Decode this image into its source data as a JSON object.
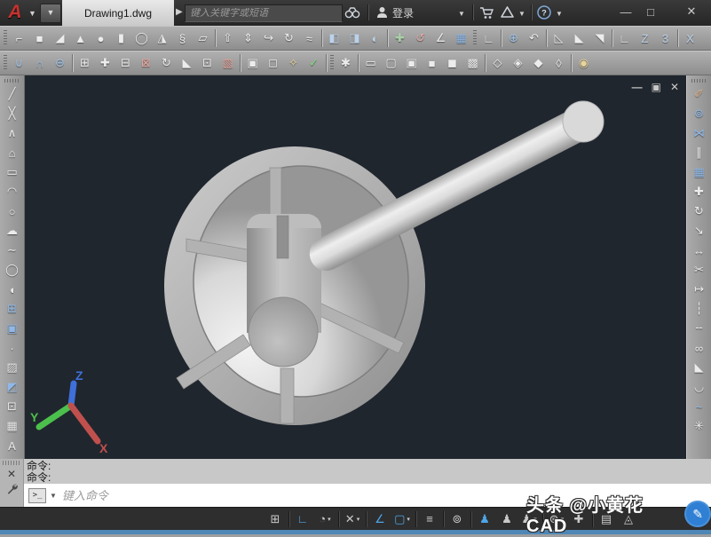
{
  "titlebar": {
    "logo_glyph": "A",
    "doc_title": "Drawing1.dwg",
    "search_placeholder": "键入关键字或短语",
    "login_label": "登录",
    "window_buttons": {
      "minimize": "—",
      "maximize": "□",
      "close": "✕"
    }
  },
  "toolbar_row1": {
    "items": [
      {
        "type": "grip",
        "name": "toolbar-grip"
      },
      {
        "name": "polysolid-icon",
        "glyph": "⌐"
      },
      {
        "name": "box-icon",
        "glyph": "■"
      },
      {
        "name": "wedge-icon",
        "glyph": "◢"
      },
      {
        "name": "cone-icon",
        "glyph": "▲"
      },
      {
        "name": "sphere-icon",
        "glyph": "●"
      },
      {
        "name": "cylinder-icon",
        "glyph": "▮"
      },
      {
        "name": "torus-icon",
        "glyph": "◯"
      },
      {
        "name": "pyramid-icon",
        "glyph": "◮"
      },
      {
        "name": "helix-icon",
        "glyph": "§"
      },
      {
        "name": "planar-surface-icon",
        "glyph": "▱"
      },
      {
        "type": "sep",
        "name": "toolbar-separator"
      },
      {
        "name": "extrude-icon",
        "glyph": "⇧"
      },
      {
        "name": "presspull-icon",
        "glyph": "⇕"
      },
      {
        "name": "sweep-icon",
        "glyph": "↪"
      },
      {
        "name": "revolve-icon",
        "glyph": "↻"
      },
      {
        "name": "loft-icon",
        "glyph": "≈"
      },
      {
        "type": "sep",
        "name": "toolbar-separator"
      },
      {
        "name": "section-plane-icon",
        "glyph": "◧",
        "color": "#bcd2ea"
      },
      {
        "name": "slice-icon",
        "glyph": "◨",
        "color": "#bcd2ea"
      },
      {
        "name": "interfere-icon",
        "glyph": "◐",
        "color": "#bcd2ea"
      },
      {
        "type": "sep",
        "name": "toolbar-separator"
      },
      {
        "name": "3d-move-icon",
        "glyph": "✚",
        "color": "#a8d0a8"
      },
      {
        "name": "3d-rotate-icon",
        "glyph": "↺",
        "color": "#e0a8a8"
      },
      {
        "name": "3d-align-icon",
        "glyph": "∠"
      },
      {
        "name": "3d-array-icon",
        "glyph": "▦",
        "color": "#8fb8e8"
      },
      {
        "type": "grip",
        "name": "toolbar-grip"
      },
      {
        "name": "ucs-icon",
        "glyph": "∟"
      },
      {
        "type": "sep",
        "name": "toolbar-separator"
      },
      {
        "name": "ucs-world-icon",
        "glyph": "⊕",
        "color": "#9fc3e8"
      },
      {
        "name": "ucs-previous-icon",
        "glyph": "↶"
      },
      {
        "type": "sep",
        "name": "toolbar-separator"
      },
      {
        "name": "ucs-face-icon",
        "glyph": "◺"
      },
      {
        "name": "ucs-object-icon",
        "glyph": "◣"
      },
      {
        "name": "ucs-view-icon",
        "glyph": "◥"
      },
      {
        "type": "sep",
        "name": "toolbar-separator"
      },
      {
        "name": "ucs-origin-icon",
        "glyph": "∟"
      },
      {
        "name": "ucs-z-axis-icon",
        "glyph": "Z",
        "color": "#bcd2ea"
      },
      {
        "name": "ucs-3-point-icon",
        "glyph": "3",
        "color": "#bcd2ea"
      },
      {
        "type": "sep",
        "name": "toolbar-separator"
      },
      {
        "name": "ucs-rotate-x-icon",
        "glyph": "X",
        "color": "#bcd2ea"
      }
    ]
  },
  "toolbar_row2": {
    "items": [
      {
        "type": "grip",
        "name": "toolbar-grip"
      },
      {
        "name": "union-icon",
        "glyph": "∪",
        "color": "#9fc3e8"
      },
      {
        "name": "intersect-icon",
        "glyph": "∩",
        "color": "#9fc3e8"
      },
      {
        "name": "subtract-icon",
        "glyph": "⊖",
        "color": "#9fc3e8"
      },
      {
        "type": "sep",
        "name": "toolbar-separator"
      },
      {
        "name": "extrude-faces-icon",
        "glyph": "⊞"
      },
      {
        "name": "move-faces-icon",
        "glyph": "✚"
      },
      {
        "name": "copy-faces-icon",
        "glyph": "⊟"
      },
      {
        "name": "delete-faces-icon",
        "glyph": "⊠",
        "color": "#e8a8a0"
      },
      {
        "name": "rotate-faces-icon",
        "glyph": "↻"
      },
      {
        "name": "taper-faces-icon",
        "glyph": "◣"
      },
      {
        "name": "offset-faces-icon",
        "glyph": "⊡"
      },
      {
        "name": "color-faces-icon",
        "glyph": "▧",
        "color": "#e8a8a0"
      },
      {
        "type": "sep",
        "name": "toolbar-separator"
      },
      {
        "name": "shell-icon",
        "glyph": "▣"
      },
      {
        "name": "separate-icon",
        "glyph": "◻"
      },
      {
        "name": "imprint-icon",
        "glyph": "✧",
        "color": "#e8d49a"
      },
      {
        "name": "check-icon",
        "glyph": "✓",
        "color": "#7ddb7d"
      },
      {
        "type": "sep",
        "name": "toolbar-separator"
      },
      {
        "type": "grip",
        "name": "toolbar-grip"
      },
      {
        "name": "extract-edges-icon",
        "glyph": "✱"
      },
      {
        "type": "sep",
        "name": "toolbar-separator"
      },
      {
        "name": "visual-style-2d-wireframe-icon",
        "glyph": "▭"
      },
      {
        "name": "visual-style-wireframe-icon",
        "glyph": "▢"
      },
      {
        "name": "visual-style-hidden-icon",
        "glyph": "▣"
      },
      {
        "name": "visual-style-realistic-icon",
        "glyph": "■"
      },
      {
        "name": "visual-style-conceptual-icon",
        "glyph": "◼"
      },
      {
        "name": "visual-style-shaded-icon",
        "glyph": "▩"
      },
      {
        "type": "sep",
        "name": "toolbar-separator"
      },
      {
        "name": "view-sw-isometric-icon",
        "glyph": "◇"
      },
      {
        "name": "view-se-isometric-icon",
        "glyph": "◈"
      },
      {
        "name": "view-ne-isometric-icon",
        "glyph": "◆"
      },
      {
        "name": "view-nw-isometric-icon",
        "glyph": "◊"
      },
      {
        "type": "sep",
        "name": "toolbar-separator"
      },
      {
        "name": "render-icon",
        "glyph": "◉",
        "color": "#e8d49a"
      }
    ]
  },
  "left_toolbar": {
    "items": [
      {
        "type": "grip",
        "name": "toolbar-grip"
      },
      {
        "name": "line-icon",
        "glyph": "╱"
      },
      {
        "name": "construction-line-icon",
        "glyph": "╳"
      },
      {
        "name": "polyline-icon",
        "glyph": "∧"
      },
      {
        "name": "polygon-icon",
        "glyph": "⌂"
      },
      {
        "name": "rectangle-icon",
        "glyph": "▭"
      },
      {
        "name": "arc-icon",
        "glyph": "◠"
      },
      {
        "name": "circle-icon",
        "glyph": "○"
      },
      {
        "name": "revision-cloud-icon",
        "glyph": "☁"
      },
      {
        "name": "spline-icon",
        "glyph": "∼"
      },
      {
        "name": "ellipse-icon",
        "glyph": "◯"
      },
      {
        "name": "ellipse-arc-icon",
        "glyph": "◖"
      },
      {
        "name": "insert-block-icon",
        "glyph": "⊞",
        "color": "#8fb8e8"
      },
      {
        "name": "make-block-icon",
        "glyph": "▣",
        "color": "#8fb8e8"
      },
      {
        "name": "point-icon",
        "glyph": "∙"
      },
      {
        "name": "hatch-icon",
        "glyph": "▨"
      },
      {
        "name": "gradient-icon",
        "glyph": "◩",
        "color": "#8fb8e8"
      },
      {
        "name": "region-icon",
        "glyph": "⊡"
      },
      {
        "name": "table-icon",
        "glyph": "▦"
      },
      {
        "name": "multiline-text-icon",
        "glyph": "A"
      }
    ]
  },
  "right_toolbar": {
    "items": [
      {
        "type": "grip",
        "name": "toolbar-grip"
      },
      {
        "name": "erase-icon",
        "glyph": "✐",
        "color": "#e0b890"
      },
      {
        "name": "copy-icon",
        "glyph": "⊚",
        "color": "#8fb8e8"
      },
      {
        "name": "mirror-icon",
        "glyph": "⋈",
        "color": "#8fb8e8"
      },
      {
        "name": "offset-icon",
        "glyph": "∥"
      },
      {
        "name": "array-icon",
        "glyph": "▦",
        "color": "#8fb8e8"
      },
      {
        "name": "move-icon",
        "glyph": "✚"
      },
      {
        "name": "rotate-icon",
        "glyph": "↻"
      },
      {
        "name": "scale-icon",
        "glyph": "↘"
      },
      {
        "name": "stretch-icon",
        "glyph": "↔"
      },
      {
        "name": "trim-icon",
        "glyph": "✂"
      },
      {
        "name": "extend-icon",
        "glyph": "↦"
      },
      {
        "name": "break-at-point-icon",
        "glyph": "┆"
      },
      {
        "name": "break-icon",
        "glyph": "╌"
      },
      {
        "name": "join-icon",
        "glyph": "∞"
      },
      {
        "name": "chamfer-icon",
        "glyph": "◣"
      },
      {
        "name": "fillet-icon",
        "glyph": "◡"
      },
      {
        "name": "blend-curves-icon",
        "glyph": "~",
        "color": "#8fb8e8"
      },
      {
        "name": "explode-icon",
        "glyph": "✳"
      }
    ]
  },
  "viewport": {
    "controls": {
      "minimize": "—",
      "restore": "▣",
      "close": "✕"
    },
    "ucs": {
      "x": "X",
      "y": "Y",
      "z": "Z"
    }
  },
  "command": {
    "history": [
      {
        "text": "命令:"
      },
      {
        "text": "命令:"
      }
    ],
    "prompt_glyph": ">_",
    "input_placeholder": "键入命令"
  },
  "statusbar": {
    "items": [
      {
        "name": "snap-mode-icon",
        "glyph": "⊞"
      },
      {
        "type": "sep",
        "name": "statusbar-separator"
      },
      {
        "name": "ortho-mode-icon",
        "glyph": "∟",
        "active": true
      },
      {
        "name": "polar-tracking-icon",
        "glyph": "◔",
        "arrow": true
      },
      {
        "type": "sep",
        "name": "statusbar-separator"
      },
      {
        "name": "isometric-drafting-icon",
        "glyph": "✕",
        "arrow": true
      },
      {
        "type": "sep",
        "name": "statusbar-separator"
      },
      {
        "name": "object-snap-tracking-icon",
        "glyph": "∠",
        "active": true
      },
      {
        "name": "object-snap-icon",
        "glyph": "▢",
        "active": true,
        "arrow": true
      },
      {
        "type": "sep",
        "name": "statusbar-separator"
      },
      {
        "name": "lineweight-icon",
        "glyph": "≡"
      },
      {
        "type": "sep",
        "name": "statusbar-separator"
      },
      {
        "name": "selection-cycling-icon",
        "glyph": "⊚"
      },
      {
        "type": "sep",
        "name": "statusbar-separator"
      },
      {
        "name": "annotation-visibility-icon",
        "glyph": "♟",
        "active": true
      },
      {
        "name": "autoscale-icon",
        "glyph": "♟"
      },
      {
        "name": "annotation-scale-icon",
        "glyph": "♟",
        "arrow": true
      },
      {
        "type": "sep",
        "name": "statusbar-separator"
      },
      {
        "name": "workspace-switching-icon",
        "glyph": "⊛",
        "arrow": true
      },
      {
        "name": "annotation-monitor-icon",
        "glyph": "✚"
      },
      {
        "type": "sep",
        "name": "statusbar-separator"
      },
      {
        "name": "quick-properties-icon",
        "glyph": "▤"
      },
      {
        "name": "isolate-objects-icon",
        "glyph": "◬"
      }
    ]
  },
  "watermark": {
    "text": "头条 @小黄花CAD",
    "logo_glyph": "✎"
  },
  "colors": {
    "viewport_bg": "#20262e",
    "statusbar_bg": "#2e2e2e",
    "accent_blue": "#4da6e8",
    "command_bg": "#c8c8c8",
    "input_bg": "#ffffff",
    "bottom_strip": "#4f87b6",
    "watermark_blue": "#2f80d4",
    "ucs_x": "#c0504d",
    "ucs_y": "#4cc04c",
    "ucs_z": "#3f6fd8",
    "m_rim_light": "#cccccc",
    "m_rim_mid": "#acacac",
    "m_rim_dark": "#8e8e8e",
    "m_bowl_hi": "#f3f3f3",
    "m_bowl_lo": "#969696",
    "m_spoke": "#b2b2b2",
    "m_spoke_dark": "#8f8f8f",
    "m_hub_light": "#c6c6c6",
    "m_hub_mid": "#a8a8a8",
    "m_hub_dark": "#8d8d8d",
    "m_handle_hi": "#eeeeee",
    "m_handle_lo": "#8f8f8f",
    "m_cap": "#d9d9d9"
  }
}
